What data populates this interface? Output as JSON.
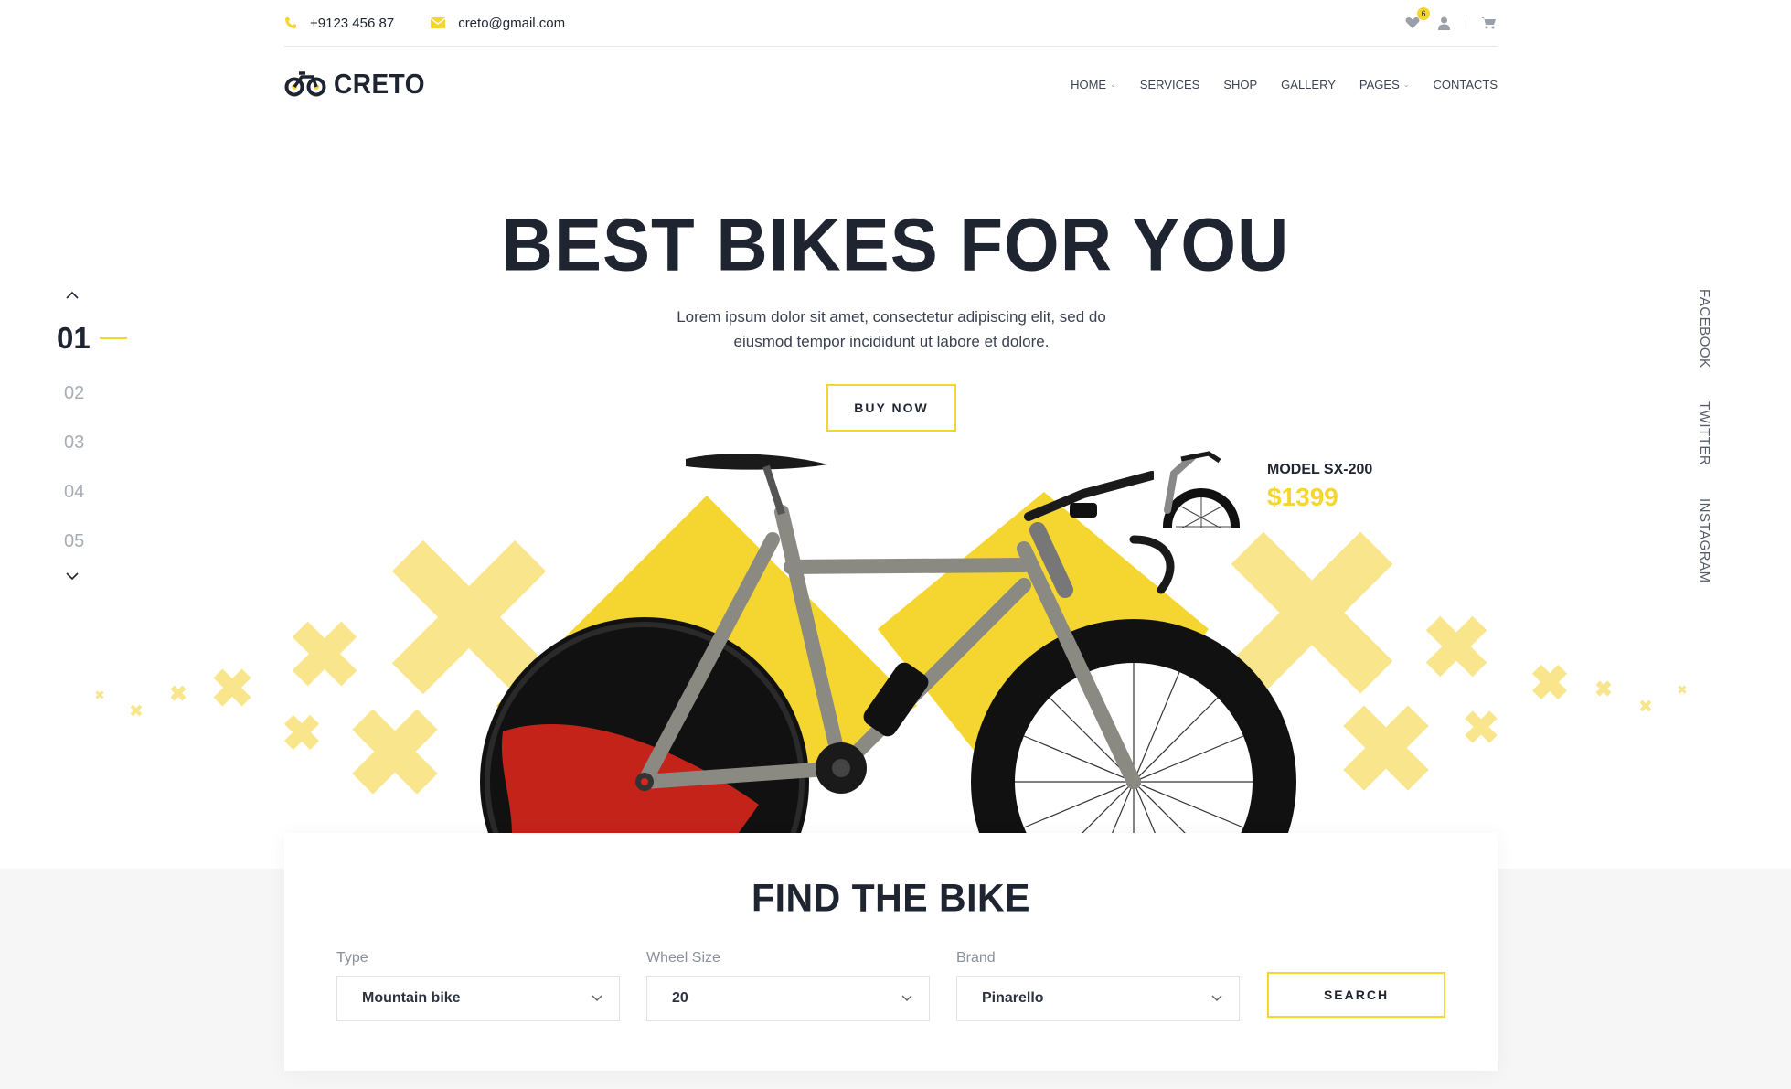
{
  "topbar": {
    "phone": "+9123 456 87",
    "email": "creto@gmail.com",
    "wishlist_count": "6"
  },
  "brand": {
    "logo_text": "CRETO"
  },
  "nav": {
    "items": [
      {
        "label": "HOME",
        "has_dropdown": true
      },
      {
        "label": "SERVICES",
        "has_dropdown": false
      },
      {
        "label": "SHOP",
        "has_dropdown": false
      },
      {
        "label": "GALLERY",
        "has_dropdown": false
      },
      {
        "label": "PAGES",
        "has_dropdown": true
      },
      {
        "label": "CONTACTS",
        "has_dropdown": false
      }
    ]
  },
  "slider": {
    "active": "01",
    "slides": [
      "02",
      "03",
      "04",
      "05"
    ]
  },
  "social": [
    "FACEBOOK",
    "TWITTER",
    "INSTAGRAM"
  ],
  "hero": {
    "title": "BEST BIKES FOR YOU",
    "text": "Lorem ipsum dolor sit amet, consectetur adipiscing elit, sed do eiusmod tempor incididunt ut labore et dolore.",
    "button": "BUY NOW"
  },
  "model_card": {
    "name": "MODEL SX-200",
    "price": "$1399"
  },
  "finder": {
    "title": "FIND THE BIKE",
    "fields": [
      {
        "label": "Type",
        "value": "Mountain bike"
      },
      {
        "label": "Wheel Size",
        "value": "20"
      },
      {
        "label": "Brand",
        "value": "Pinarello"
      }
    ],
    "button": "SEARCH"
  },
  "colors": {
    "accent": "#f5d630",
    "dark": "#1e2430",
    "muted": "#a8adb5"
  }
}
